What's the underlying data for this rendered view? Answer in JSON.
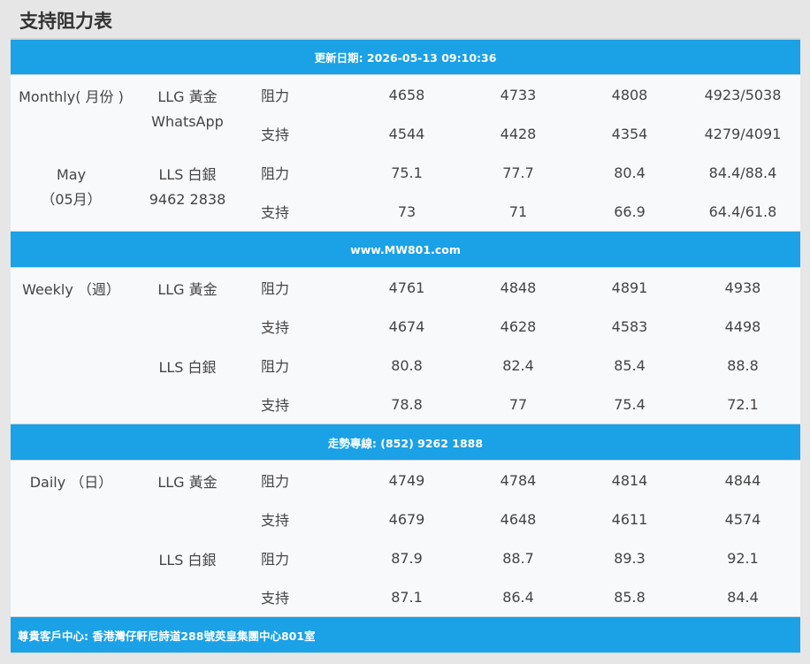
{
  "title": "支持阻力表",
  "bands": {
    "update": "更新日期: 2026-05-13 09:10:36",
    "website": "www.MW801.com",
    "hotline": "走勢專線: (852) 9262 1888",
    "address": "尊貴客戶中心: 香港灣仔軒尼詩道288號英皇集團中心801室"
  },
  "monthly": {
    "period_line1": "Monthly( 月份 )",
    "period_line2": "May",
    "period_line3": "（05月）",
    "gold_label": "LLG 黃金",
    "gold_sub": "WhatsApp",
    "silver_label": "LLS 白銀",
    "silver_sub": "9462 2838",
    "rows": [
      {
        "type": "阻力",
        "v": [
          "4658",
          "4733",
          "4808",
          "4923/5038"
        ]
      },
      {
        "type": "支持",
        "v": [
          "4544",
          "4428",
          "4354",
          "4279/4091"
        ]
      },
      {
        "type": "阻力",
        "v": [
          "75.1",
          "77.7",
          "80.4",
          "84.4/88.4"
        ]
      },
      {
        "type": "支持",
        "v": [
          "73",
          "71",
          "66.9",
          "64.4/61.8"
        ]
      }
    ]
  },
  "weekly": {
    "period": "Weekly （週）",
    "gold_label": "LLG 黃金",
    "silver_label": "LLS 白銀",
    "rows": [
      {
        "type": "阻力",
        "v": [
          "4761",
          "4848",
          "4891",
          "4938"
        ]
      },
      {
        "type": "支持",
        "v": [
          "4674",
          "4628",
          "4583",
          "4498"
        ]
      },
      {
        "type": "阻力",
        "v": [
          "80.8",
          "82.4",
          "85.4",
          "88.8"
        ]
      },
      {
        "type": "支持",
        "v": [
          "78.8",
          "77",
          "75.4",
          "72.1"
        ]
      }
    ]
  },
  "daily": {
    "period": "Daily （日）",
    "gold_label": "LLG 黃金",
    "silver_label": "LLS 白銀",
    "rows": [
      {
        "type": "阻力",
        "v": [
          "4749",
          "4784",
          "4814",
          "4844"
        ]
      },
      {
        "type": "支持",
        "v": [
          "4679",
          "4648",
          "4611",
          "4574"
        ]
      },
      {
        "type": "阻力",
        "v": [
          "87.9",
          "88.7",
          "89.3",
          "92.1"
        ]
      },
      {
        "type": "支持",
        "v": [
          "87.1",
          "86.4",
          "85.8",
          "84.4"
        ]
      }
    ]
  }
}
